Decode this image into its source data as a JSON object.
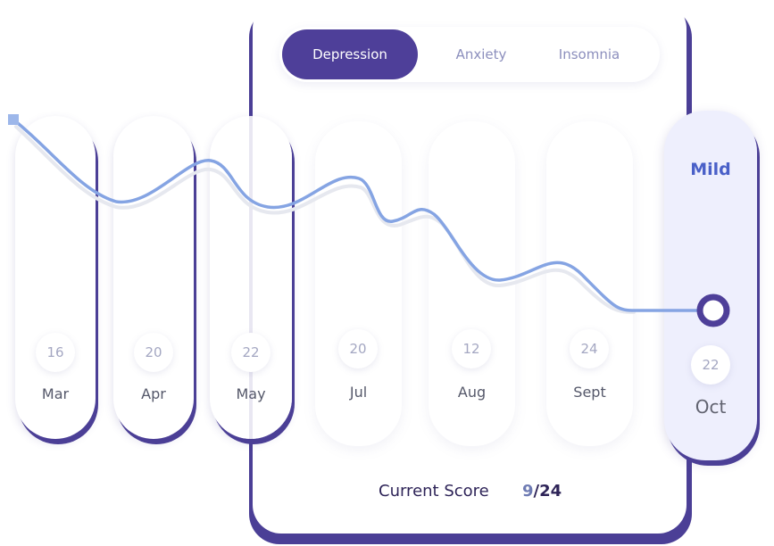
{
  "tabs": [
    {
      "label": "Depression",
      "active": true
    },
    {
      "label": "Anxiety",
      "active": false
    },
    {
      "label": "Insomnia",
      "active": false
    }
  ],
  "months": [
    {
      "month": "Mar",
      "score": "16"
    },
    {
      "month": "Apr",
      "score": "20"
    },
    {
      "month": "May",
      "score": "22"
    },
    {
      "month": "Jul",
      "score": "20"
    },
    {
      "month": "Aug",
      "score": "12"
    },
    {
      "month": "Sept",
      "score": "24"
    },
    {
      "month": "Oct",
      "score": "22",
      "selected": true,
      "severity": "Mild"
    }
  ],
  "current_score": {
    "label": "Current Score",
    "value": "9",
    "total": "/24"
  },
  "colors": {
    "accent": "#4e3f99",
    "trend_line": "#85a4e3",
    "severity_text": "#4a60c8"
  }
}
